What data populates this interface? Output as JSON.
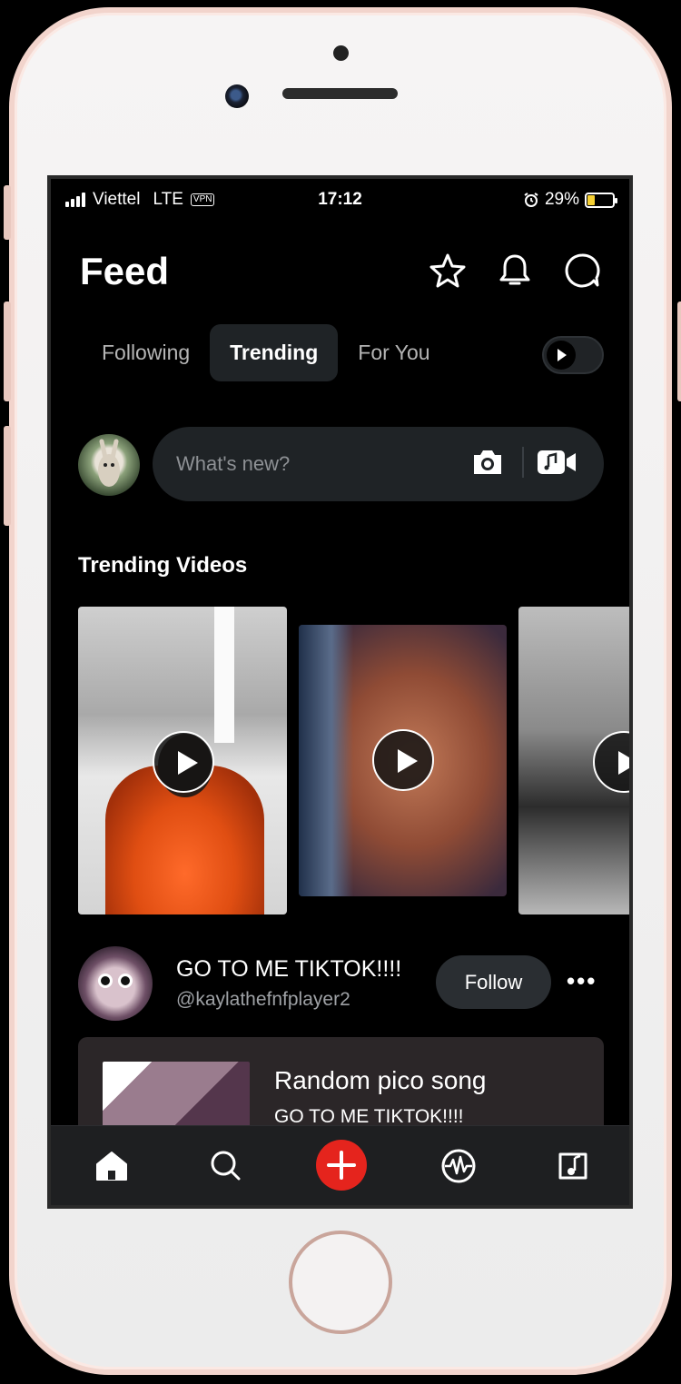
{
  "status_bar": {
    "carrier": "Viettel",
    "network": "LTE",
    "vpn": "VPN",
    "time": "17:12",
    "battery": "29%"
  },
  "header": {
    "title": "Feed",
    "icons": [
      "star-icon",
      "bell-icon",
      "chat-icon"
    ]
  },
  "tabs": [
    {
      "label": "Following",
      "active": false
    },
    {
      "label": "Trending",
      "active": true
    },
    {
      "label": "For You",
      "active": false
    }
  ],
  "composer": {
    "placeholder": "What's new?"
  },
  "trending": {
    "title": "Trending Videos",
    "videos": [
      {
        "id": "video-1"
      },
      {
        "id": "video-2"
      },
      {
        "id": "video-3"
      }
    ]
  },
  "post": {
    "name": "GO TO ME TIKTOK!!!!",
    "handle": "@kaylathefnfplayer2",
    "follow_label": "Follow",
    "more_label": "•••",
    "card_title": "Random pico song",
    "card_subtitle": "GO TO ME TIKTOK!!!!"
  },
  "bottom_nav": [
    "home-icon",
    "search-icon",
    "add-icon",
    "activity-icon",
    "music-icon"
  ],
  "colors": {
    "accent_red": "#e5241d",
    "surface": "#1f2326",
    "background": "#000000",
    "battery_fill": "#f5d033"
  }
}
